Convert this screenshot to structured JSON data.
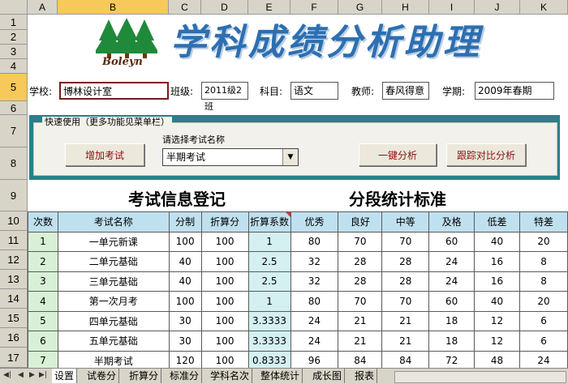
{
  "columns": [
    "A",
    "B",
    "C",
    "D",
    "E",
    "F",
    "G",
    "H",
    "I",
    "J",
    "K"
  ],
  "rows": [
    "1",
    "2",
    "3",
    "4",
    "5",
    "6",
    "7",
    "8",
    "9",
    "10",
    "11",
    "12",
    "13",
    "14",
    "15",
    "16",
    "17"
  ],
  "selected_column": "B",
  "selected_row": "5",
  "title": "学科成绩分析助理",
  "logo_text": "Boleyn",
  "info": {
    "school_label": "学校:",
    "school_value": "博林设计室",
    "class_label": "班级:",
    "class_value": "2011级2班",
    "subject_label": "科目:",
    "subject_value": "语文",
    "teacher_label": "教师:",
    "teacher_value": "春风得意",
    "term_label": "学期:",
    "term_value": "2009年春期"
  },
  "quick": {
    "caption": "快速使用（更多功能见菜单栏）",
    "add_exam": "增加考试",
    "select_label": "请选择考试名称",
    "selected_exam": "半期考试",
    "one_click": "一键分析",
    "track": "跟踪对比分析"
  },
  "section_left": "考试信息登记",
  "section_right": "分段统计标准",
  "table": {
    "headers": [
      "次数",
      "考试名称",
      "分制",
      "折算分",
      "折算系数",
      "优秀",
      "良好",
      "中等",
      "及格",
      "低差",
      "特差"
    ],
    "rows": [
      [
        "1",
        "一单元新课",
        "100",
        "100",
        "1",
        "80",
        "70",
        "70",
        "60",
        "40",
        "20"
      ],
      [
        "2",
        "二单元基础",
        "40",
        "100",
        "2.5",
        "32",
        "28",
        "28",
        "24",
        "16",
        "8"
      ],
      [
        "3",
        "三单元基础",
        "40",
        "100",
        "2.5",
        "32",
        "28",
        "28",
        "24",
        "16",
        "8"
      ],
      [
        "4",
        "第一次月考",
        "100",
        "100",
        "1",
        "80",
        "70",
        "70",
        "60",
        "40",
        "20"
      ],
      [
        "5",
        "四单元基础",
        "30",
        "100",
        "3.3333",
        "24",
        "21",
        "21",
        "18",
        "12",
        "6"
      ],
      [
        "6",
        "五单元基础",
        "30",
        "100",
        "3.3333",
        "24",
        "21",
        "21",
        "18",
        "12",
        "6"
      ],
      [
        "7",
        "半期考试",
        "120",
        "100",
        "0.8333",
        "96",
        "84",
        "84",
        "72",
        "48",
        "24"
      ]
    ]
  },
  "tabs": [
    "设置",
    "试卷分",
    "折算分",
    "标准分",
    "学科名次",
    "整体统计",
    "成长图",
    "报表"
  ],
  "active_tab": "设置"
}
